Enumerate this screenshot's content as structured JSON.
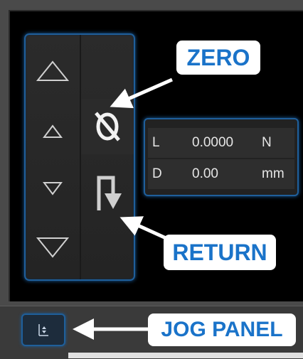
{
  "jog_buttons": [
    {
      "name": "jog-up-fast-button",
      "icon": "triangle-up-large-icon"
    },
    {
      "name": "jog-up-slow-button",
      "icon": "triangle-up-small-icon"
    },
    {
      "name": "jog-down-slow-button",
      "icon": "triangle-down-small-icon"
    },
    {
      "name": "jog-down-fast-button",
      "icon": "triangle-down-large-icon"
    }
  ],
  "zero_button": {
    "icon": "zero-slashed-icon"
  },
  "return_button": {
    "icon": "return-arrow-icon"
  },
  "readout": {
    "rows": [
      {
        "label": "L",
        "value": "0.0000",
        "unit": "N"
      },
      {
        "label": "D",
        "value": "0.00",
        "unit": "mm"
      }
    ]
  },
  "callouts": {
    "zero": "ZERO",
    "return": "RETURN",
    "jog_panel": "JOG PANEL"
  },
  "jog_toggle": {
    "icon": "jog-panel-toggle-icon"
  },
  "colors": {
    "accent": "#1f5f9b",
    "callout_text": "#1a73c9"
  }
}
